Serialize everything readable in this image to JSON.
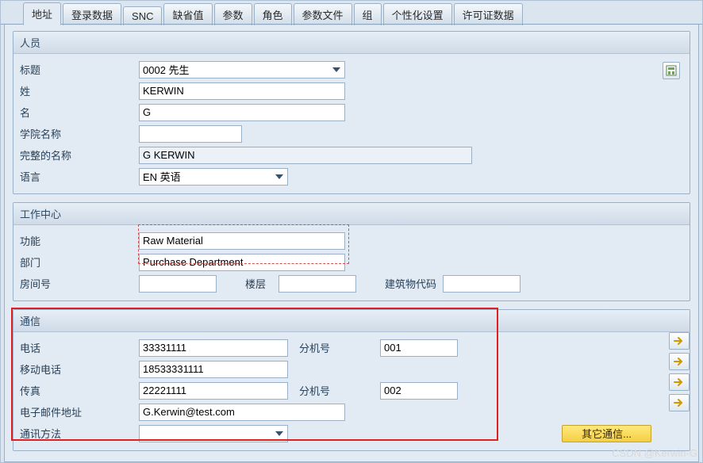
{
  "tabs": {
    "items": [
      {
        "label": "地址",
        "active": true
      },
      {
        "label": "登录数据"
      },
      {
        "label": "SNC"
      },
      {
        "label": "缺省值"
      },
      {
        "label": "参数"
      },
      {
        "label": "角色"
      },
      {
        "label": "参数文件"
      },
      {
        "label": "组"
      },
      {
        "label": "个性化设置"
      },
      {
        "label": "许可证数据"
      }
    ]
  },
  "person": {
    "group_title": "人员",
    "labels": {
      "title": "标题",
      "lastname": "姓",
      "firstname": "名",
      "academic": "学院名称",
      "fullname": "完整的名称",
      "language": "语言"
    },
    "values": {
      "title": "0002 先生",
      "lastname": "KERWIN",
      "firstname": "G",
      "academic": "",
      "fullname": "G KERWIN",
      "language": "EN 英语"
    }
  },
  "workcenter": {
    "group_title": "工作中心",
    "labels": {
      "function": "功能",
      "department": "部门",
      "room": "房间号",
      "floor": "楼层",
      "building": "建筑物代码"
    },
    "values": {
      "function": "Raw Material",
      "department": "Purchase Department",
      "room": "",
      "floor": "",
      "building": ""
    }
  },
  "comm": {
    "group_title": "通信",
    "labels": {
      "phone": "电话",
      "ext": "分机号",
      "mobile": "移动电话",
      "fax": "传真",
      "email": "电子邮件地址",
      "method": "通讯方法",
      "other": "其它通信..."
    },
    "values": {
      "phone": "33331111",
      "phone_ext": "001",
      "mobile": "18533331111",
      "fax": "22221111",
      "fax_ext": "002",
      "email": "G.Kerwin@test.com",
      "method": ""
    }
  },
  "watermark": "CSDN @Kerwin-G"
}
